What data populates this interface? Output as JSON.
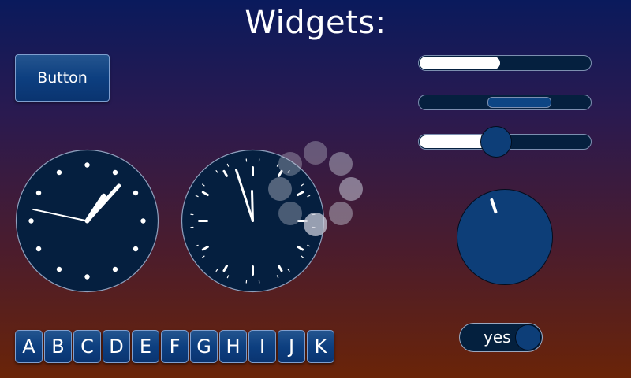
{
  "title": "Widgets:",
  "button": {
    "label": "Button"
  },
  "progress_bar": {
    "value": 0.47
  },
  "range_slider": {
    "low": 0.4,
    "high": 0.77
  },
  "slider": {
    "value": 0.45
  },
  "analog_clock": {
    "hour": 1,
    "minute": 7,
    "second": 47
  },
  "analog_clock_2": {
    "hour": 11,
    "minute": 57,
    "second": 15
  },
  "knob": {
    "value": 0.45
  },
  "switch": {
    "label": "yes",
    "on": true
  },
  "keys": [
    "A",
    "B",
    "C",
    "D",
    "E",
    "F",
    "G",
    "H",
    "I",
    "J",
    "K"
  ],
  "colors": {
    "widget_fill": "#0d3e78",
    "dial_face": "#051f3f",
    "accent": "#ffffff",
    "background_top": "#0a1a5c",
    "background_bottom": "#6a2408"
  }
}
